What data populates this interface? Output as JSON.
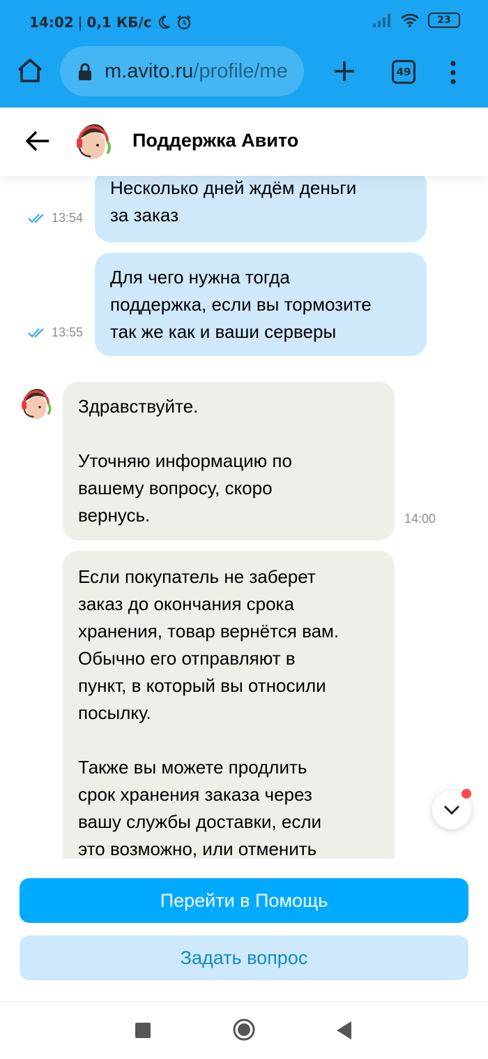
{
  "status_bar": {
    "time": "14:02",
    "speed": "0,1 КБ/с",
    "battery": "23"
  },
  "browser": {
    "url_host": "m.avito.ru",
    "url_path": "/profile/me",
    "tab_count": "49"
  },
  "chat": {
    "title": "Поддержка Авито",
    "messages": [
      {
        "direction": "out",
        "lines": [
          "Несколько дней ждём деньги",
          "за заказ"
        ],
        "time": "13:54",
        "read": true
      },
      {
        "direction": "out",
        "lines": [
          "Для чего нужна тогда",
          "поддержка, если вы тормозите",
          "так же как и ваши серверы"
        ],
        "time": "13:55",
        "read": true
      },
      {
        "direction": "in",
        "lines": [
          "Здравствуйте.",
          "",
          "Уточняю информацию по",
          "вашему вопросу, скоро",
          "вернусь."
        ],
        "time": "14:00"
      },
      {
        "direction": "in",
        "lines": [
          "Если покупатель не заберет",
          "заказ до окончания срока",
          "хранения, товар вернётся вам.",
          "Обычно его отправляют в",
          "пункт, в который вы относили",
          "посылку.",
          "",
          "Также вы можете продлить",
          "срок хранения заказа через",
          "вашу службы доставки, если",
          "это возможно, или отменить"
        ]
      }
    ]
  },
  "actions": {
    "primary": "Перейти в Помощь",
    "secondary": "Задать вопрос"
  },
  "colors": {
    "chrome": "#1aa4f1",
    "outgoing_bubble": "#cfe9fb",
    "incoming_bubble": "#f0eee9",
    "primary_button": "#00aaff",
    "secondary_button": "#cde9fb",
    "read_check": "#2aa7e8"
  }
}
